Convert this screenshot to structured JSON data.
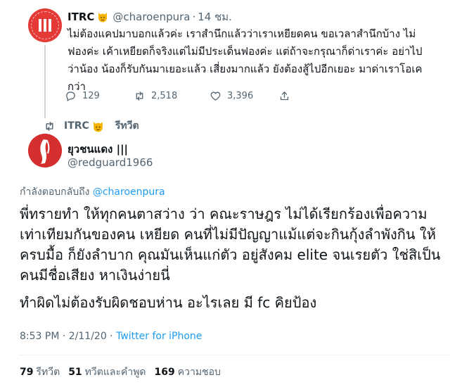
{
  "parent_tweet": {
    "author_name": "ITRC",
    "author_emoji": "cat-emoji-icon",
    "handle": "@charoenpura",
    "separator": "·",
    "time": "14 ชม.",
    "text": "ไม่ต้องแคปมาบอกแล้วค่ะ เราสำนึกแล้วว่าเราเหยียดคน ขอเวลาสำนึกบ้าง ไม่ฟองค่ะ เค้าเหยียดก็จริงแต่ไม่มีประเด็นฟองค่ะ แต่ถ้าจะกรุณาก็ด่าเราค่ะ อย่าไปว่าน้อง น้องก็รับกันมาเยอะแล้ว เสี่ยงมากแล้ว ยังต้องสู้ไปอีกเยอะ มาด่าเราโอเคกว่า",
    "replies": "129",
    "retweets": "2,518",
    "likes": "3,396"
  },
  "retweet_banner": {
    "name": "ITRC",
    "label": "รีทวีต"
  },
  "main_tweet": {
    "author_name": "ยุวชนแดง |||",
    "handle": "@redguard1966",
    "reply_prefix": "กำลังตอบกลับถึง",
    "reply_mention": "@charoenpura",
    "paragraph1": "พี่ทรายทำ ให้ทุกคนตาสว่าง ว่า คณะราษฎร ไม่ได้เรียกร้องเพื่อความเท่าเทียมกันของคน เหยียด คนที่ไม่มีปัญญาแม้แต่จะกินกุ้งลำพังกิน ให้ครบมื้อ ก็ยังลำบาก  คุณมันเห็นแก่ตัว อยู่สังคม elite จนเรยตัว ใช่สิเป็นคนมีชื่อเสียง หาเงินง่ายนี่",
    "paragraph2": "ทำผิดไม่ต้องรับผิดชอบห่าน  อะไรเลย  มี fc คิยป้อง",
    "timestamp": "8:53 PM · 2/11/20 ·",
    "via": "Twitter for iPhone"
  },
  "stats": {
    "retweets_num": "79",
    "retweets_label": "รีทวีต",
    "quotes_num": "51",
    "quotes_label": "ทวีตและคำพูด",
    "likes_num": "169",
    "likes_label": "ความชอบ"
  },
  "colors": {
    "accent": "#1d9bf0",
    "muted": "#536471",
    "avatar_red": "#e53935"
  }
}
